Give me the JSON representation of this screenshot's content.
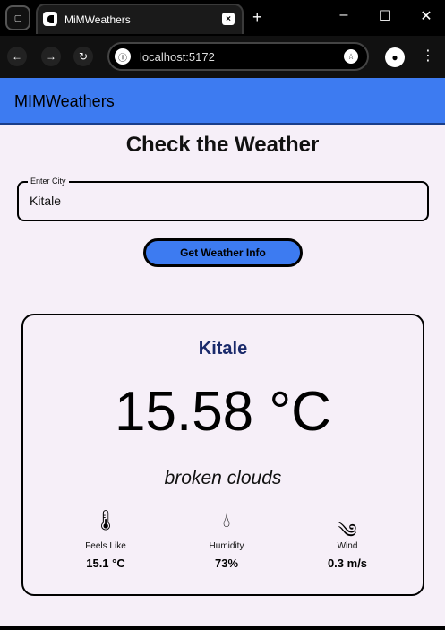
{
  "browser": {
    "tab_title": "MiMWeathers",
    "url": "localhost:5172",
    "new_tab_label": "+",
    "window_controls": {
      "minimize": "–",
      "maximize": "☐",
      "close": "✕"
    }
  },
  "app": {
    "title": "MIMWeathers"
  },
  "page": {
    "heading": "Check the Weather",
    "city_field": {
      "label": "Enter City",
      "value": "Kitale"
    },
    "get_button_label": "Get Weather Info"
  },
  "weather": {
    "city": "Kitale",
    "temperature": "15.58 °C",
    "description": "broken clouds",
    "stats": [
      {
        "icon": "thermometer-icon",
        "label": "Feels Like",
        "value": "15.1 °C"
      },
      {
        "icon": "humidity-icon",
        "label": "Humidity",
        "value": "73%"
      },
      {
        "icon": "wind-icon",
        "label": "Wind",
        "value": "0.3 m/s"
      }
    ]
  },
  "colors": {
    "accent": "#3d7bf1",
    "background": "#f6eff8"
  }
}
